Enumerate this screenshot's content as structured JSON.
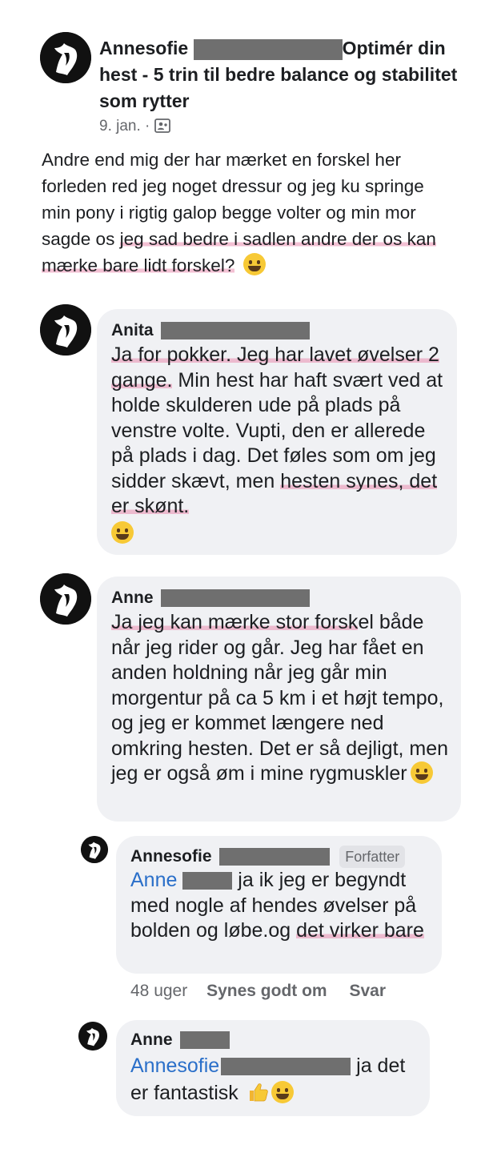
{
  "post": {
    "author": "Annesofie",
    "title": "Optimér din hest - 5 trin til bedre balance og stabilitet som rytter",
    "date": "9. jan. ·",
    "body_part1": "Andre end mig der har mærket en forskel her forleden red jeg noget dressur og jeg ku springe min pony i rigtig galop begge volter og min mor sagde os ",
    "body_highlight": "jeg sad bedre i sadlen andre der os kan mærke bare lidt forskel?",
    "emoji": "grinning-squinting-face"
  },
  "comments": [
    {
      "name": "Anita",
      "hl1": "Ja for pokker. Jeg har lavet øvelser 2 gange.",
      "text1": " Min hest har haft svært ved at holde skulderen ude på plads på venstre volte. Vupti, den er allerede på plads i dag. Det føles som om jeg sidder skævt, men ",
      "hl2": "hesten synes, det er skønt.",
      "emoji": "grinning-face"
    },
    {
      "name": "Anne",
      "hl1": "Ja jeg kan mærke stor forsk",
      "text1": "el både når jeg rider og går. Jeg har fået en anden holdning når jeg går min morgentur på ca 5 km i et højt tempo, og jeg er kommet længere ned omkring hesten. Det er så dejligt, men jeg er også øm i mine rygmuskler",
      "emoji": "grinning-sweat-face"
    }
  ],
  "replies": [
    {
      "name": "Annesofie",
      "badge": "Forfatter",
      "mention": "Anne",
      "text1": " ja ik jeg er begyndt med nogle af hendes øvelser på bolden og løbe.og ",
      "hl1": "det virker bare",
      "time": "48 uger",
      "like": "Synes godt om",
      "reply": "Svar"
    },
    {
      "name": "Anne",
      "mention": "Annesofie",
      "text1": " ja det er fantastisk",
      "emoji1": "thumbs-up",
      "emoji2": "grinning-face"
    }
  ]
}
